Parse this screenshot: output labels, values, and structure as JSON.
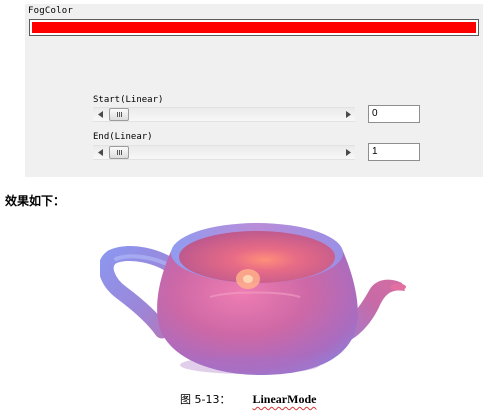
{
  "panel": {
    "fog_color_label": "FogColor",
    "fog_color": "#ff0000",
    "start": {
      "label": "Start(Linear)",
      "value": "0"
    },
    "end": {
      "label": "End(Linear)",
      "value": "1"
    }
  },
  "article": {
    "effect_text": "效果如下：",
    "caption_figure": "图 5-13：",
    "caption_mode": "LinearMode"
  },
  "colors": {
    "panel_bg": "#f0f0f0",
    "teapot_body": "#c8669e",
    "teapot_rim": "#8f9cf0"
  },
  "icons": [
    "scroll-left-arrow-icon",
    "scroll-right-arrow-icon",
    "thumb-grip-icon"
  ]
}
